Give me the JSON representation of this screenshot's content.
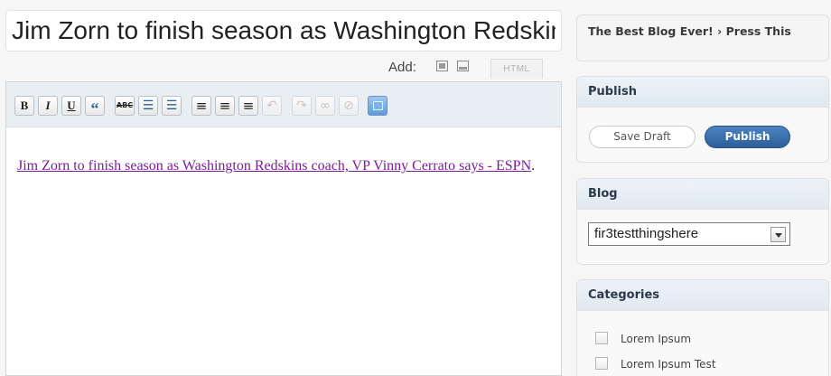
{
  "editor": {
    "title": "Jim Zorn to finish season as Washington Redskins coach, VP Vinny Cerrato says - ESPN",
    "add_label": "Add:",
    "media_icons": [
      "image-icon",
      "media-icon"
    ],
    "html_tab": "HTML",
    "toolbar": [
      {
        "name": "bold-button",
        "glyph": "B"
      },
      {
        "name": "italic-button",
        "glyph": "I"
      },
      {
        "name": "underline-button",
        "glyph": "U"
      },
      {
        "name": "blockquote-button",
        "glyph": "“"
      },
      {
        "name": "strikethrough-button",
        "glyph": "ABC"
      },
      {
        "name": "bullet-list-button",
        "glyph": "☰"
      },
      {
        "name": "numbered-list-button",
        "glyph": "☰"
      },
      {
        "name": "align-left-button",
        "glyph": "≡"
      },
      {
        "name": "align-center-button",
        "glyph": "≡"
      },
      {
        "name": "align-right-button",
        "glyph": "≡"
      },
      {
        "name": "undo-button",
        "glyph": "↶"
      },
      {
        "name": "redo-button",
        "glyph": "↷"
      },
      {
        "name": "link-button",
        "glyph": "∞"
      },
      {
        "name": "unlink-button",
        "glyph": "⊘"
      },
      {
        "name": "fullscreen-button",
        "glyph": ""
      }
    ],
    "content_link": "Jim Zorn to finish season as Washington Redskins coach, VP Vinny Cerrato says - ESPN",
    "content_suffix": "."
  },
  "sidebar": {
    "blog_title": "The Best Blog Ever! › Press This",
    "publish": {
      "heading": "Publish",
      "save_draft": "Save Draft",
      "publish": "Publish"
    },
    "blog": {
      "heading": "Blog",
      "selected": "fir3testthingshere"
    },
    "categories": {
      "heading": "Categories",
      "items": [
        "Lorem Ipsum",
        "Lorem Ipsum Test"
      ]
    }
  },
  "colors": {
    "link": "#7a1f98",
    "publish_button": "#2c5f98",
    "panel_header": "#e1e9f1"
  }
}
